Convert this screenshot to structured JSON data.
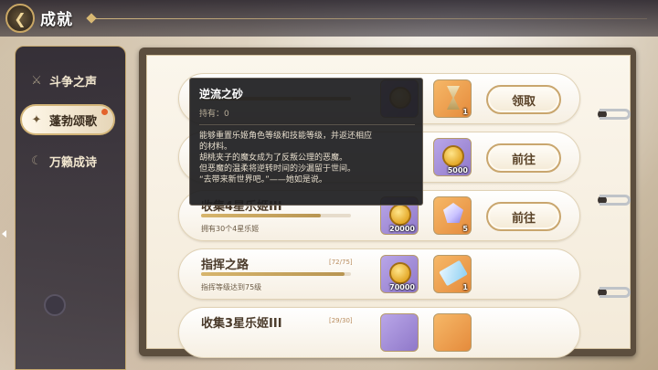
{
  "header": {
    "title": "成就",
    "back_icon": "back-arrow-icon"
  },
  "sidebar": {
    "items": [
      {
        "label": "斗争之声",
        "icon": "swords-icon",
        "active": false
      },
      {
        "label": "蓬勃颂歌",
        "icon": "horn-icon",
        "active": true,
        "badge": "red-dot"
      },
      {
        "label": "万籁成诗",
        "icon": "moon-icon",
        "active": false
      }
    ]
  },
  "rows": [
    {
      "name": "",
      "progress": "",
      "desc": "",
      "rewards": [
        {
          "type": "coin",
          "qty": ""
        },
        {
          "type": "hourglass",
          "qty": "1"
        }
      ],
      "button": "领取"
    },
    {
      "name": "",
      "progress": "",
      "desc": "",
      "rewards": [
        {
          "type": "coin",
          "qty": "5000"
        }
      ],
      "button": "前往"
    },
    {
      "name": "收集4星乐姬III",
      "progress": "",
      "desc": "拥有30个4星乐姬",
      "rewards": [
        {
          "type": "coin",
          "qty": "20000"
        },
        {
          "type": "gem",
          "qty": "5"
        }
      ],
      "button": "前往"
    },
    {
      "name": "指挥之路",
      "progress": "[72/75]",
      "fill": 0.96,
      "desc": "指挥等级达到75级",
      "rewards": [
        {
          "type": "coin",
          "qty": "70000"
        },
        {
          "type": "ticket",
          "qty": "1"
        }
      ],
      "button": ""
    },
    {
      "name": "收集3星乐姬III",
      "progress": "[29/30]",
      "desc": "",
      "rewards": [],
      "button": ""
    }
  ],
  "tooltip": {
    "title": "逆流之砂",
    "hold_label": "持有：",
    "hold_value": "0",
    "lines": [
      "能够重置乐姬角色等级和技能等级，并返还相应",
      "的材料。",
      "胡桃夹子的魔女成为了反叛公理的恶魔。",
      "但恶魔的温柔将逆转时间的沙漏留于世间。",
      "“去带来新世界吧。”——她如是说。"
    ]
  },
  "colors": {
    "accent": "#c9a66e",
    "badge": "#e3632c",
    "tooltip_bg": "#1e1e20"
  }
}
